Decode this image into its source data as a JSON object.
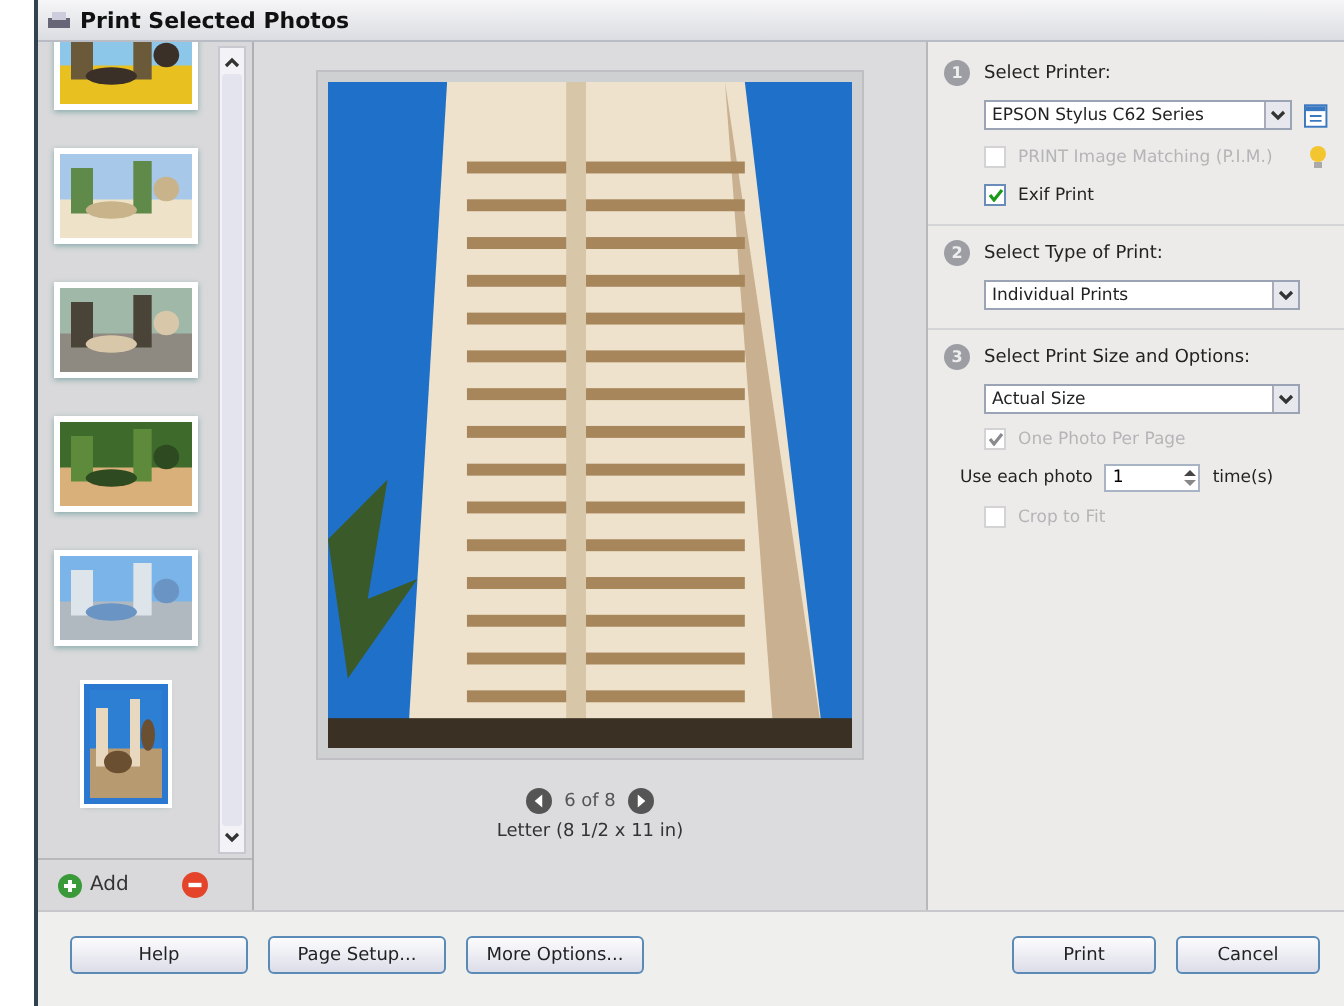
{
  "window": {
    "title": "Print Selected Photos"
  },
  "thumbnails": [
    {
      "kind": "picture",
      "selected": false
    },
    {
      "kind": "picture",
      "selected": false
    },
    {
      "kind": "picture",
      "selected": false
    },
    {
      "kind": "picture",
      "selected": false
    },
    {
      "kind": "picture",
      "selected": false
    },
    {
      "kind": "picture",
      "selected": true
    }
  ],
  "thumb_actions": {
    "add": "Add"
  },
  "preview": {
    "kind": "picture",
    "page_indicator": "6 of 8",
    "paper": "Letter (8 1/2 x 11 in)"
  },
  "steps": [
    {
      "number": "1",
      "label": "Select Printer:",
      "dropdown": "EPSON Stylus C62 Series",
      "options": [
        {
          "kind": "checkbox",
          "label": "PRINT Image Matching (P.I.M.)",
          "checked": false,
          "disabled": true
        },
        {
          "kind": "checkbox",
          "label": "Exif Print",
          "checked": true,
          "disabled": false
        }
      ]
    },
    {
      "number": "2",
      "label": "Select Type of Print:",
      "dropdown": "Individual Prints"
    },
    {
      "number": "3",
      "label": "Select Print Size and Options:",
      "dropdown": "Actual Size",
      "options": [
        {
          "kind": "checkbox",
          "label": "One Photo Per Page",
          "checked": true,
          "disabled": true
        },
        {
          "kind": "spinner",
          "label": "Use each photo",
          "value": "1",
          "unit": "time(s)"
        },
        {
          "kind": "checkbox",
          "label": "Crop to Fit",
          "checked": false,
          "disabled": true
        }
      ]
    }
  ],
  "buttons_left": [
    "Help",
    "Page Setup...",
    "More Options..."
  ],
  "buttons_right": [
    "Print",
    "Cancel"
  ]
}
